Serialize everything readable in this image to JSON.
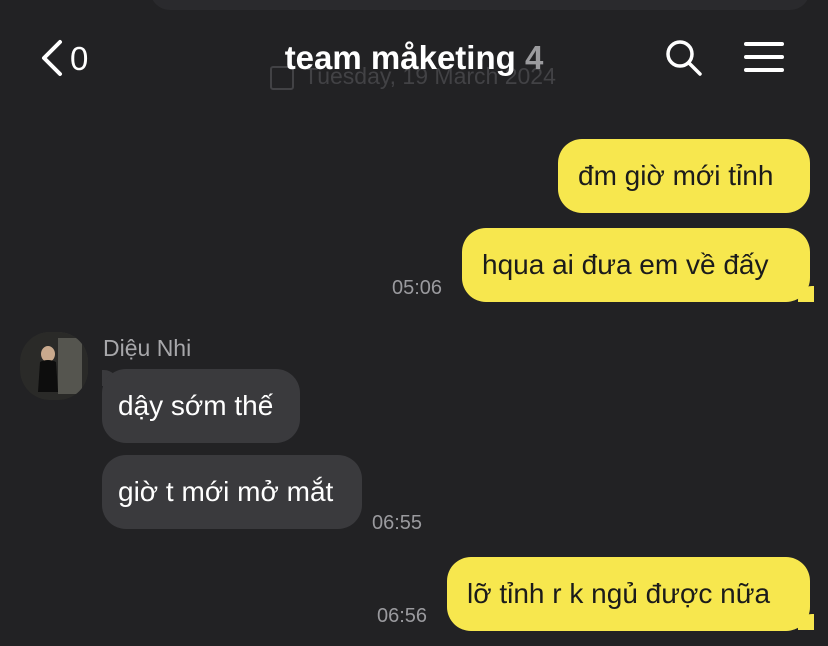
{
  "header": {
    "back_count": "0",
    "title": "team måketing",
    "member_count": "4",
    "date_ghost": "Tuesday, 19 March 2024"
  },
  "messages": [
    {
      "direction": "out",
      "text": "đm giờ mới tỉnh"
    },
    {
      "direction": "out",
      "text": "hqua ai đưa em về đấy",
      "time": "05:06"
    },
    {
      "direction": "in",
      "sender": "Diệu Nhi",
      "text": "dậy sớm thế"
    },
    {
      "direction": "in",
      "text": "giờ t mới mở mắt",
      "time": "06:55"
    },
    {
      "direction": "out",
      "text": "lỡ tỉnh r k ngủ được nữa",
      "time": "06:56"
    }
  ],
  "colors": {
    "background": "#222224",
    "outgoing_bubble": "#f7e74e",
    "incoming_bubble": "#3a3a3d",
    "timestamp": "#9a9a9e"
  },
  "icons": {
    "back": "chevron-left-icon",
    "search": "search-icon",
    "menu": "hamburger-menu-icon",
    "avatar": "user-avatar"
  }
}
